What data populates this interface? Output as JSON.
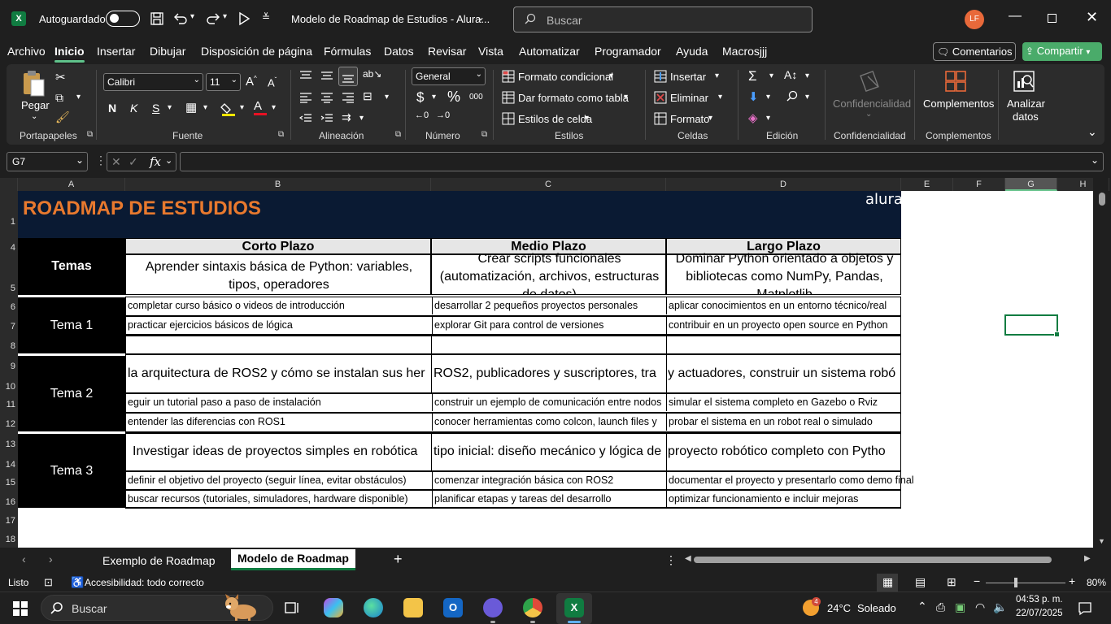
{
  "titlebar": {
    "app_icon": "X",
    "autosave_label": "Autoguardado",
    "doc_title": "Modelo de Roadmap de Estudios - Alura...",
    "search_placeholder": "Buscar",
    "avatar_initials": "LF"
  },
  "menu": {
    "items": [
      "Archivo",
      "Inicio",
      "Insertar",
      "Dibujar",
      "Disposición de página",
      "Fórmulas",
      "Datos",
      "Revisar",
      "Vista",
      "Automatizar",
      "Programador",
      "Ayuda",
      "Macrosjjj"
    ],
    "active": "Inicio",
    "comments_label": "Comentarios",
    "share_label": "Compartir"
  },
  "ribbon": {
    "paste_label": "Pegar",
    "clipboard_group": "Portapapeles",
    "font_name": "Calibri",
    "font_size": "11",
    "font_group": "Fuente",
    "align_group": "Alineación",
    "number_format": "General",
    "number_group": "Número",
    "cond_format": "Formato condicional",
    "table_format": "Dar formato como tabla",
    "cell_styles": "Estilos de celda",
    "styles_group": "Estilos",
    "insert": "Insertar",
    "delete": "Eliminar",
    "format": "Formato",
    "cells_group": "Celdas",
    "editing_group": "Edición",
    "confidentiality_btn": "Confidencialidad",
    "confidentiality_group": "Confidencialidad",
    "addins_btn": "Complementos",
    "addins_group": "Complementos",
    "analyze_btn_1": "Analizar",
    "analyze_btn_2": "datos",
    "bold": "N",
    "italic": "K",
    "underline": "S"
  },
  "formula_bar": {
    "name_box": "G7",
    "formula": ""
  },
  "columns": [
    "A",
    "B",
    "C",
    "D",
    "E",
    "F",
    "G",
    "H"
  ],
  "rows": [
    "1",
    "4",
    "5",
    "6",
    "7",
    "8",
    "9",
    "10",
    "11",
    "12",
    "13",
    "14",
    "15",
    "16",
    "17",
    "18"
  ],
  "sheet": {
    "title": "ROADMAP DE ESTUDIOS",
    "logo": "alura",
    "themes_header": "Temas",
    "headers": [
      "Corto Plazo",
      "Medio Plazo",
      "Largo Plazo"
    ],
    "row5": [
      "Aprender sintaxis básica de Python: variables, tipos, operadores",
      "Crear scripts funcionales (automatización, archivos, estructuras de datos)",
      "Dominar Python orientado a objetos y bibliotecas como NumPy, Pandas, Matplotlib"
    ],
    "tema1": "Tema 1",
    "tema1_rows": [
      [
        "completar curso básico o videos de introducción",
        "desarrollar 2 pequeños proyectos personales",
        "aplicar conocimientos en un entorno técnico/real"
      ],
      [
        "practicar ejercicios básicos de lógica",
        "explorar Git para control de versiones",
        "contribuir en un proyecto open source en Python"
      ]
    ],
    "tema2": "Tema 2",
    "tema2_main": [
      "la arquitectura de ROS2 y cómo se instalan sus her",
      "ROS2, publicadores y suscriptores, tra",
      "y actuadores, construir un sistema robó"
    ],
    "tema2_rows": [
      [
        "eguir un tutorial paso a paso de instalación",
        "construir un ejemplo de comunicación entre nodos",
        "simular el sistema completo en Gazebo o Rviz"
      ],
      [
        "entender las diferencias con ROS1",
        "conocer herramientas como colcon, launch files y",
        "probar el sistema en un robot real o simulado"
      ]
    ],
    "tema3": "Tema 3",
    "tema3_main": [
      "Investigar ideas de proyectos simples en robótica",
      "tipo inicial: diseño mecánico y lógica de",
      "proyecto robótico completo con Pytho"
    ],
    "tema3_rows": [
      [
        "definir el objetivo del proyecto (seguir línea, evitar obstáculos)",
        "comenzar integración básica con ROS2",
        "documentar el proyecto y presentarlo como demo final"
      ],
      [
        "buscar recursos (tutoriales, simuladores, hardware disponible)",
        "planificar etapas y tareas del desarrollo",
        "optimizar funcionamiento e incluir mejoras"
      ]
    ]
  },
  "tabs": {
    "items": [
      "Exemplo de Roadmap",
      "Modelo de Roadmap"
    ],
    "active": "Modelo de Roadmap"
  },
  "status": {
    "ready": "Listo",
    "accessibility": "Accesibilidad: todo correcto",
    "zoom": "80%"
  },
  "taskbar": {
    "search_placeholder": "Buscar",
    "weather_badge": "4",
    "temperature": "24°C",
    "weather": "Soleado",
    "time": "04:53 p. m.",
    "date": "22/07/2025"
  },
  "colors": {
    "excel_green": "#107c41",
    "title_orange": "#e8792e",
    "header_navy": "#0a1a33",
    "share_green": "#4aab6a"
  }
}
